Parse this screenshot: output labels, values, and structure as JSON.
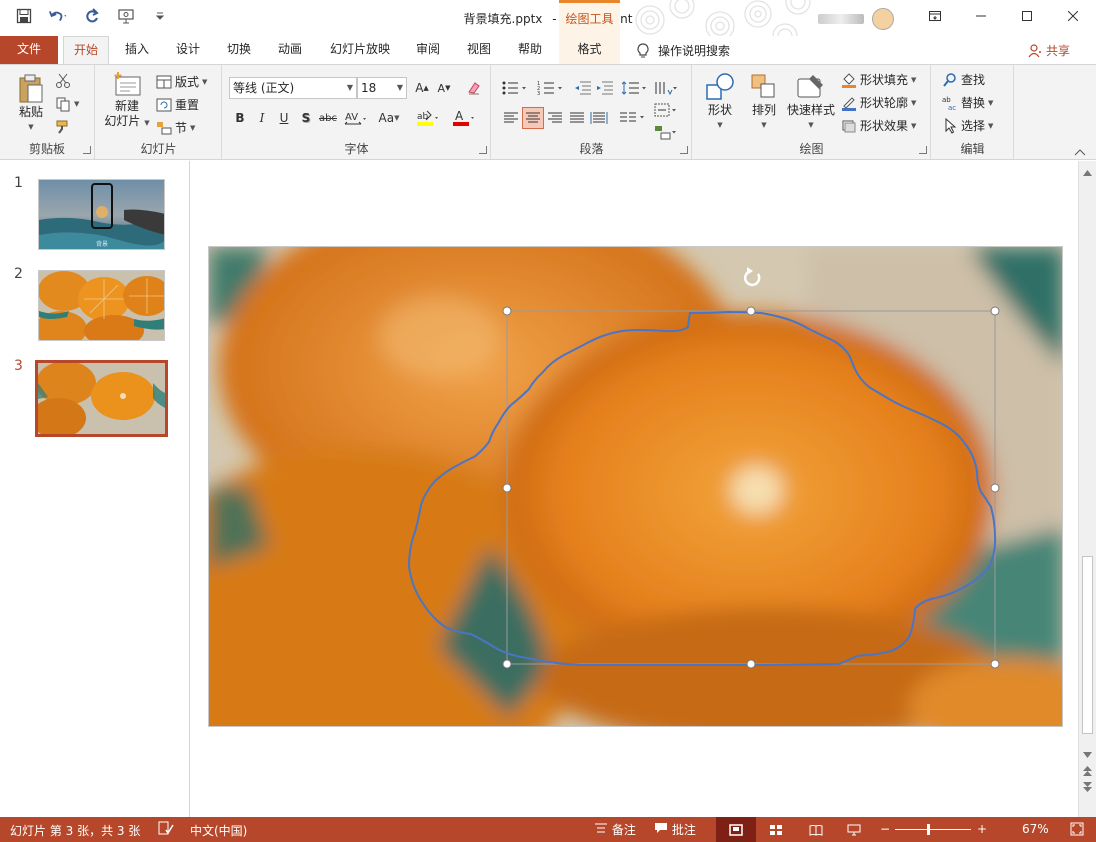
{
  "title_bar": {
    "document_title": "背景填充.pptx",
    "separator": "-",
    "app_name": "PowerPoint",
    "context_tool_label": "绘图工具",
    "qat_icons": [
      "save-icon",
      "undo-icon",
      "redo-icon",
      "presentation-icon",
      "customize-qat-icon"
    ]
  },
  "tabs": [
    {
      "label": "文件",
      "id": "file"
    },
    {
      "label": "开始",
      "id": "home",
      "active": true
    },
    {
      "label": "插入",
      "id": "insert"
    },
    {
      "label": "设计",
      "id": "design"
    },
    {
      "label": "切换",
      "id": "transitions"
    },
    {
      "label": "动画",
      "id": "animations"
    },
    {
      "label": "幻灯片放映",
      "id": "slideshow"
    },
    {
      "label": "审阅",
      "id": "review"
    },
    {
      "label": "视图",
      "id": "view"
    },
    {
      "label": "帮助",
      "id": "help"
    },
    {
      "label": "格式",
      "id": "format"
    }
  ],
  "tell_me": "操作说明搜索",
  "share": "共享",
  "ribbon": {
    "clipboard": {
      "label": "剪贴板",
      "paste": "粘贴"
    },
    "slides": {
      "label": "幻灯片",
      "new_slide_line1": "新建",
      "new_slide_line2": "幻灯片",
      "layout": "版式",
      "reset": "重置",
      "section": "节"
    },
    "font": {
      "label": "字体",
      "font_name": "等线 (正文)",
      "font_size": "18",
      "bold": "B",
      "italic": "I",
      "underline": "U",
      "shadow": "S",
      "strike": "abc",
      "case": "Aa"
    },
    "paragraph": {
      "label": "段落"
    },
    "drawing": {
      "label": "绘图",
      "shapes": "形状",
      "arrange": "排列",
      "quick_styles": "快速样式",
      "shape_fill": "形状填充",
      "shape_outline": "形状轮廓",
      "shape_effects": "形状效果"
    },
    "editing": {
      "label": "编辑",
      "find": "查找",
      "replace": "替换",
      "select": "选择"
    }
  },
  "slides": [
    {
      "number": "1",
      "thumb_caption": "背景"
    },
    {
      "number": "2"
    },
    {
      "number": "3",
      "current": true
    }
  ],
  "status": {
    "slide_info": "幻灯片 第 3 张，共 3 张",
    "language": "中文(中国)",
    "notes": "备注",
    "comments": "批注",
    "zoom": "67%"
  },
  "colors": {
    "accent": "#b7472a",
    "context_tab": "#e8862b",
    "shape_outline": "#4472c4"
  }
}
